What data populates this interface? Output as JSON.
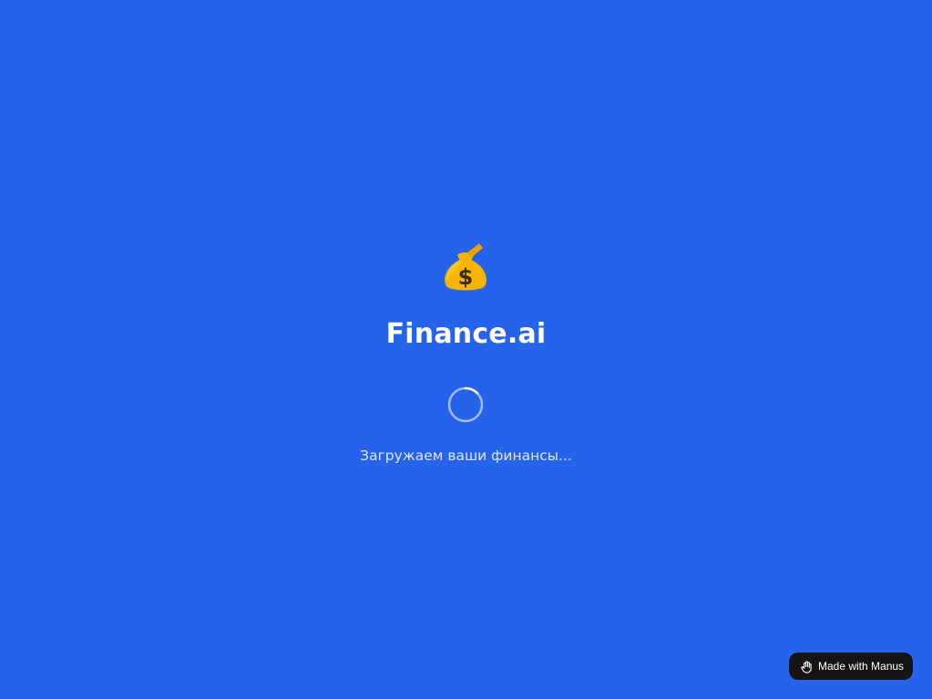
{
  "app": {
    "logo_icon": "money-bag-icon",
    "title": "Finance.ai"
  },
  "loading": {
    "indicator": "spinner",
    "message": "Загружаем ваши финансы..."
  },
  "badge": {
    "icon": "manus-hand-icon",
    "label": "Made with Manus"
  },
  "colors": {
    "background": "#2563eb",
    "text": "#ffffff",
    "badge_background": "#151515"
  }
}
